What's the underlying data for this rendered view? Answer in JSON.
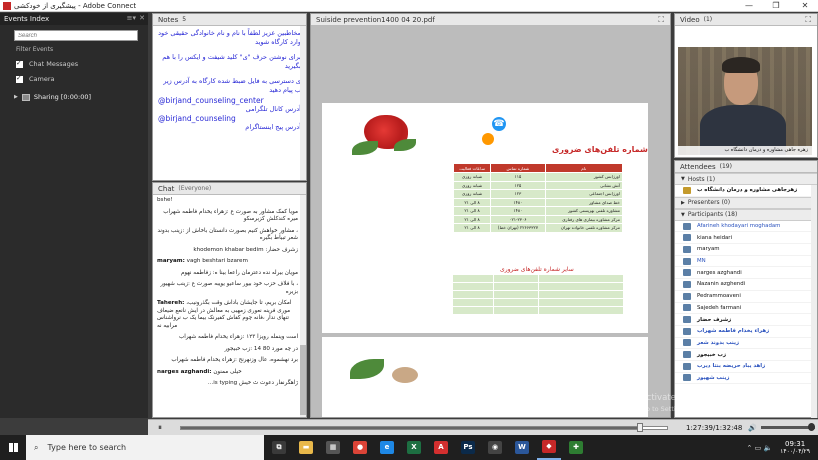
{
  "window": {
    "title": "پیشگیری از خودکشی - Adobe Connect",
    "minimize": "—",
    "maximize": "❐",
    "close": "✕"
  },
  "events": {
    "title": "Events Index",
    "menu_glyph": "≡▾",
    "close_glyph": "✕",
    "search_placeholder": "Search",
    "filter_label": "Filter Events",
    "chat_messages_label": "Chat Messages",
    "camera_label": "Camera",
    "sharing_label": "Sharing [0:00:00]"
  },
  "notes": {
    "title": "Notes",
    "count": "5",
    "paragraphs": [
      "مخاطبین عزیز لطفاً با نام و نام خانوادگی حقیقی خود وارد کارگاه شوید",
      "برای نوشتن حرف \"ی\" کلید شیفت و ایکس را با هم بگیرید",
      "ی دسترسی به فایل ضبط شده کارگاه به آدرس زیر ب پیام دهید"
    ],
    "handle_1": "@birjand_counseling_center",
    "handle_1_caption": "آدرس کانال تلگرامی",
    "handle_2": "@birjand_counseling",
    "handle_2_caption": "آدرس پیج اینستاگرام"
  },
  "chat": {
    "title": "Chat",
    "audience": "(Everyone)",
    "messages": [
      {
        "text": "bshe!"
      },
      {
        "text": "مویا کمک مشاور به صورت ع :زهراء یخدام فاطمه شهراب میره کندکلش کزبرسکو"
      },
      {
        "text": "، مشاور خواهش کنیم بصورت دانستان باخاش از :زینب بدوند شعر تبیاط بگیره"
      },
      {
        "text": "زشرف حضار: khodemon khabar bedim"
      },
      {
        "name": "maryam:",
        "text": " vagh beshtari bzarem"
      },
      {
        "text": "مویان بیرله نده دعترمان راععا بینا ه: زفاطمه نهوم"
      },
      {
        "text": "، با فلاف حزب خود بیور ساعیو یویبه صورت ع :زینب شهیور بزیره"
      },
      {
        "name": "Tahereh:",
        "text": " ،امکان بریم، تا جایشان باداش وقت بگذرونیب موری فرینه نعوری زمهبی به معالش در ایش نانعع ضیعاف تنهای ندار ،فانه چوم کفاش کفیرنک بیما یک ب نرواشناس مرابیه نه"
      },
      {
        "text": "است وینمله رویزا ۱۲۳ :زهراء یخدام فاطمه شهراب"
      },
      {
        "text": "در چه مورد 80 14 :زب خبیجور"
      },
      {
        "text": "برد نهشموه، عال وزنهرنح :زهراء یخدام فاطمه شهراب"
      },
      {
        "name": "narges azghandi:",
        "text": " خیلی ممنون"
      },
      {
        "text": "ژاهگرنفار دعوت ث خیش is typing..."
      }
    ]
  },
  "document": {
    "title": "Suiside prevention1400 04 20.pdf",
    "slide_title": "شماره تلفن‌های ضروری",
    "columns": [
      "نام",
      "شماره تماس",
      "ساعات فعالیت"
    ],
    "rows": [
      [
        "اورژانس کشور",
        "۱۱۵",
        "شبانه روزی"
      ],
      [
        "آتش نشانی",
        "۱۲۵",
        "شبانه روزی"
      ],
      [
        "اورژانس اجتماعی",
        "۱۲۳",
        "شبانه روزی"
      ],
      [
        "خط صدای مشاور",
        "۱۴۸۰",
        "۸ الی ۲۱"
      ],
      [
        "مشاوره تلفنی بهزیستی کشور",
        "۱۴۸۰",
        "۸ الی ۲۱"
      ],
      [
        "مرکز مشاوره بیماری های رفتاری",
        "۰۲۱-۲۳۰۶",
        "۸ الی ۲۱"
      ],
      [
        "مرکز مشاوره تلفنی خانواده تهران",
        "۲۲۶۶۳۳۲۷ (تهران خط)",
        "۸ الی ۲۱"
      ]
    ],
    "other_numbers_title": "سایر شماره تلفن‌های ضروری"
  },
  "video": {
    "title": "Video",
    "count": "(1)",
    "caption": "زهره جاهی مشاوره و درمان دانشگاه ب"
  },
  "attendees": {
    "title": "Attendees",
    "count": "(19)",
    "hosts_label": "Hosts (1)",
    "host_name": "زهرجاهی مشاوره و درمان دانشگاه ب",
    "presenters_label": "Presenters (0)",
    "participants_label": "Participants (18)",
    "participants": [
      {
        "name": "Afarineh khodayari moghadam",
        "rtl": false,
        "me": true
      },
      {
        "name": "kiana heidari",
        "rtl": false,
        "me": false
      },
      {
        "name": "maryam",
        "rtl": false,
        "me": false
      },
      {
        "name": "MN",
        "rtl": false,
        "me": true
      },
      {
        "name": "narges azghandi",
        "rtl": false,
        "me": false
      },
      {
        "name": "Nazanin azghendi",
        "rtl": false,
        "me": false
      },
      {
        "name": "Pedrammoaveni",
        "rtl": false,
        "me": false
      },
      {
        "name": "Sajedeh farmani",
        "rtl": false,
        "me": false
      },
      {
        "name": "زشرف حضار",
        "rtl": true,
        "me": false
      },
      {
        "name": "زهراء یخدام فاطمه شهراب",
        "rtl": true,
        "me": true
      },
      {
        "name": "زینب بدوند شعر",
        "rtl": true,
        "me": true
      },
      {
        "name": "زب خبیجور",
        "rtl": true,
        "me": false
      },
      {
        "name": "زاهد یباد حریضه بنتا دیرب",
        "rtl": true,
        "me": true
      },
      {
        "name": "زینب شهیور",
        "rtl": true,
        "me": true
      }
    ]
  },
  "player": {
    "pause_glyph": "⏸",
    "time": "1:27:39/1:32:48",
    "volume_glyph": "🔊",
    "progress": 0.944
  },
  "watermark": {
    "line1": "Activate Windows",
    "line2": "Go to Settings to activate Windows."
  },
  "taskbar": {
    "search_placeholder": "Type here to search",
    "search_glyph": "⌕",
    "apps": [
      {
        "name": "task-view",
        "glyph": "⧉",
        "color": "#3a3a3a"
      },
      {
        "name": "file-explorer",
        "glyph": "▬",
        "color": "#e8b84a"
      },
      {
        "name": "app-tiles",
        "glyph": "▦",
        "color": "#555555"
      },
      {
        "name": "chrome",
        "glyph": "●",
        "color": "#db4437"
      },
      {
        "name": "internet-explorer",
        "glyph": "e",
        "color": "#1e88e5"
      },
      {
        "name": "excel",
        "glyph": "X",
        "color": "#1d6f42"
      },
      {
        "name": "acrobat",
        "glyph": "A",
        "color": "#d32f2f"
      },
      {
        "name": "photoshop",
        "glyph": "Ps",
        "color": "#0b2a4a"
      },
      {
        "name": "media",
        "glyph": "◉",
        "color": "#444444"
      },
      {
        "name": "word",
        "glyph": "W",
        "color": "#2b579a"
      },
      {
        "name": "adobe-connect",
        "glyph": "◆",
        "color": "#c62828"
      },
      {
        "name": "green-app",
        "glyph": "✚",
        "color": "#2e7d32"
      }
    ],
    "tray_glyphs": "⌃ ▭ 🔈",
    "time": "09:31",
    "date": "۱۴۰۰/۰۴/۲۹"
  }
}
